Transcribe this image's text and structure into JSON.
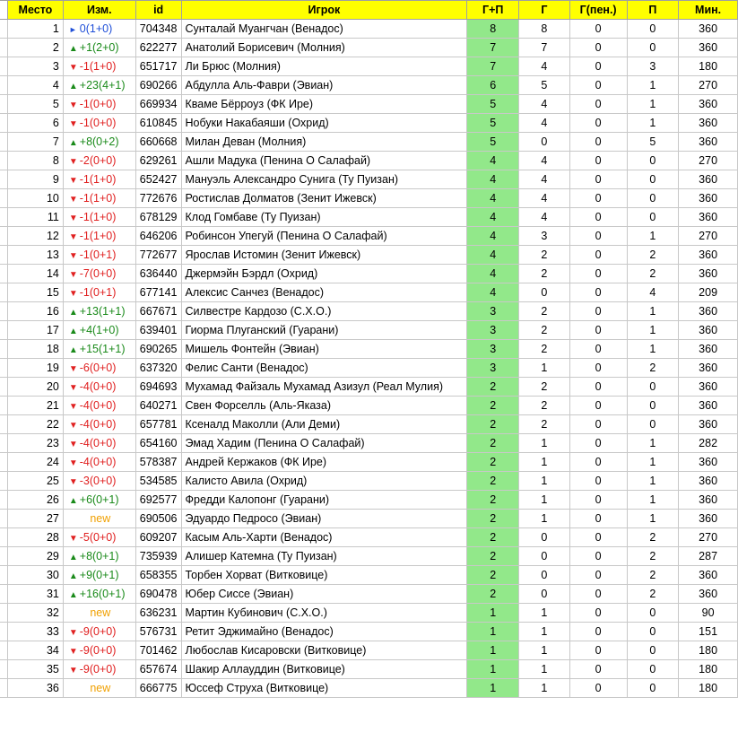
{
  "headers": {
    "place": "Место",
    "change": "Изм.",
    "id": "id",
    "player": "Игрок",
    "gp": "Г+П",
    "g": "Г",
    "gpen": "Г(пен.)",
    "p": "П",
    "min": "Мин."
  },
  "colors": {
    "header_bg": "#ffff00",
    "gp_bg": "#92e88a",
    "up": "#1a8a1a",
    "down": "#e02020",
    "same": "#1f4fd8",
    "new": "#f0a000"
  },
  "rows": [
    {
      "place": "1",
      "dir": "same",
      "change": "0(1+0)",
      "id": "704348",
      "player": "Сунталай Муангчан (Венадос)",
      "gp": "8",
      "g": "8",
      "gpen": "0",
      "p": "0",
      "min": "360"
    },
    {
      "place": "2",
      "dir": "up",
      "change": "+1(2+0)",
      "id": "622277",
      "player": "Анатолий Борисевич (Молния)",
      "gp": "7",
      "g": "7",
      "gpen": "0",
      "p": "0",
      "min": "360"
    },
    {
      "place": "3",
      "dir": "down",
      "change": "-1(1+0)",
      "id": "651717",
      "player": "Ли Брюс (Молния)",
      "gp": "7",
      "g": "4",
      "gpen": "0",
      "p": "3",
      "min": "180"
    },
    {
      "place": "4",
      "dir": "up",
      "change": "+23(4+1)",
      "id": "690266",
      "player": "Абдулла Аль-Фаври (Эвиан)",
      "gp": "6",
      "g": "5",
      "gpen": "0",
      "p": "1",
      "min": "270"
    },
    {
      "place": "5",
      "dir": "down",
      "change": "-1(0+0)",
      "id": "669934",
      "player": "Кваме Бёрроуз (ФК Ире)",
      "gp": "5",
      "g": "4",
      "gpen": "0",
      "p": "1",
      "min": "360"
    },
    {
      "place": "6",
      "dir": "down",
      "change": "-1(0+0)",
      "id": "610845",
      "player": "Нобуки Накабаяши (Охрид)",
      "gp": "5",
      "g": "4",
      "gpen": "0",
      "p": "1",
      "min": "360"
    },
    {
      "place": "7",
      "dir": "up",
      "change": "+8(0+2)",
      "id": "660668",
      "player": "Милан Деван (Молния)",
      "gp": "5",
      "g": "0",
      "gpen": "0",
      "p": "5",
      "min": "360"
    },
    {
      "place": "8",
      "dir": "down",
      "change": "-2(0+0)",
      "id": "629261",
      "player": "Ашли Мадука (Пенина О Салафай)",
      "gp": "4",
      "g": "4",
      "gpen": "0",
      "p": "0",
      "min": "270"
    },
    {
      "place": "9",
      "dir": "down",
      "change": "-1(1+0)",
      "id": "652427",
      "player": "Мануэль Александро Сунига (Ту Пуизан)",
      "gp": "4",
      "g": "4",
      "gpen": "0",
      "p": "0",
      "min": "360"
    },
    {
      "place": "10",
      "dir": "down",
      "change": "-1(1+0)",
      "id": "772676",
      "player": "Ростислав Долматов (Зенит Ижевск)",
      "gp": "4",
      "g": "4",
      "gpen": "0",
      "p": "0",
      "min": "360"
    },
    {
      "place": "11",
      "dir": "down",
      "change": "-1(1+0)",
      "id": "678129",
      "player": "Клод Гомбаве (Ту Пуизан)",
      "gp": "4",
      "g": "4",
      "gpen": "0",
      "p": "0",
      "min": "360"
    },
    {
      "place": "12",
      "dir": "down",
      "change": "-1(1+0)",
      "id": "646206",
      "player": "Робинсон Упегуй (Пенина О Салафай)",
      "gp": "4",
      "g": "3",
      "gpen": "0",
      "p": "1",
      "min": "270"
    },
    {
      "place": "13",
      "dir": "down",
      "change": "-1(0+1)",
      "id": "772677",
      "player": "Ярослав Истомин (Зенит Ижевск)",
      "gp": "4",
      "g": "2",
      "gpen": "0",
      "p": "2",
      "min": "360"
    },
    {
      "place": "14",
      "dir": "down",
      "change": "-7(0+0)",
      "id": "636440",
      "player": "Джермэйн Бэрдл (Охрид)",
      "gp": "4",
      "g": "2",
      "gpen": "0",
      "p": "2",
      "min": "360"
    },
    {
      "place": "15",
      "dir": "down",
      "change": "-1(0+1)",
      "id": "677141",
      "player": "Алексис Санчез (Венадос)",
      "gp": "4",
      "g": "0",
      "gpen": "0",
      "p": "4",
      "min": "209"
    },
    {
      "place": "16",
      "dir": "up",
      "change": "+13(1+1)",
      "id": "667671",
      "player": "Силвестре Кардозо (С.Х.О.)",
      "gp": "3",
      "g": "2",
      "gpen": "0",
      "p": "1",
      "min": "360"
    },
    {
      "place": "17",
      "dir": "up",
      "change": "+4(1+0)",
      "id": "639401",
      "player": "Гиорма Плуганский (Гуарани)",
      "gp": "3",
      "g": "2",
      "gpen": "0",
      "p": "1",
      "min": "360"
    },
    {
      "place": "18",
      "dir": "up",
      "change": "+15(1+1)",
      "id": "690265",
      "player": "Мишель Фонтейн (Эвиан)",
      "gp": "3",
      "g": "2",
      "gpen": "0",
      "p": "1",
      "min": "360"
    },
    {
      "place": "19",
      "dir": "down",
      "change": "-6(0+0)",
      "id": "637320",
      "player": "Фелис Санти (Венадос)",
      "gp": "3",
      "g": "1",
      "gpen": "0",
      "p": "2",
      "min": "360"
    },
    {
      "place": "20",
      "dir": "down",
      "change": "-4(0+0)",
      "id": "694693",
      "player": "Мухамад Файзаль Мухамад Азизул (Реал Мулия)",
      "gp": "2",
      "g": "2",
      "gpen": "0",
      "p": "0",
      "min": "360"
    },
    {
      "place": "21",
      "dir": "down",
      "change": "-4(0+0)",
      "id": "640271",
      "player": "Свен Форселль (Аль-Яказа)",
      "gp": "2",
      "g": "2",
      "gpen": "0",
      "p": "0",
      "min": "360"
    },
    {
      "place": "22",
      "dir": "down",
      "change": "-4(0+0)",
      "id": "657781",
      "player": "Ксеналд Маколли (Али Деми)",
      "gp": "2",
      "g": "2",
      "gpen": "0",
      "p": "0",
      "min": "360"
    },
    {
      "place": "23",
      "dir": "down",
      "change": "-4(0+0)",
      "id": "654160",
      "player": "Эмад Хадим (Пенина О Салафай)",
      "gp": "2",
      "g": "1",
      "gpen": "0",
      "p": "1",
      "min": "282"
    },
    {
      "place": "24",
      "dir": "down",
      "change": "-4(0+0)",
      "id": "578387",
      "player": "Андрей Кержаков (ФК Ире)",
      "gp": "2",
      "g": "1",
      "gpen": "0",
      "p": "1",
      "min": "360"
    },
    {
      "place": "25",
      "dir": "down",
      "change": "-3(0+0)",
      "id": "534585",
      "player": "Калисто Авила (Охрид)",
      "gp": "2",
      "g": "1",
      "gpen": "0",
      "p": "1",
      "min": "360"
    },
    {
      "place": "26",
      "dir": "up",
      "change": "+6(0+1)",
      "id": "692577",
      "player": "Фредди Калопонг (Гуарани)",
      "gp": "2",
      "g": "1",
      "gpen": "0",
      "p": "1",
      "min": "360"
    },
    {
      "place": "27",
      "dir": "new",
      "change": "new",
      "id": "690506",
      "player": "Эдуардо Педросо (Эвиан)",
      "gp": "2",
      "g": "1",
      "gpen": "0",
      "p": "1",
      "min": "360"
    },
    {
      "place": "28",
      "dir": "down",
      "change": "-5(0+0)",
      "id": "609207",
      "player": "Касым Аль-Харти (Венадос)",
      "gp": "2",
      "g": "0",
      "gpen": "0",
      "p": "2",
      "min": "270"
    },
    {
      "place": "29",
      "dir": "up",
      "change": "+8(0+1)",
      "id": "735939",
      "player": "Алишер Катемна (Ту Пуизан)",
      "gp": "2",
      "g": "0",
      "gpen": "0",
      "p": "2",
      "min": "287"
    },
    {
      "place": "30",
      "dir": "up",
      "change": "+9(0+1)",
      "id": "658355",
      "player": "Торбен Хорват (Витковице)",
      "gp": "2",
      "g": "0",
      "gpen": "0",
      "p": "2",
      "min": "360"
    },
    {
      "place": "31",
      "dir": "up",
      "change": "+16(0+1)",
      "id": "690478",
      "player": "Юбер Сиссе (Эвиан)",
      "gp": "2",
      "g": "0",
      "gpen": "0",
      "p": "2",
      "min": "360"
    },
    {
      "place": "32",
      "dir": "new",
      "change": "new",
      "id": "636231",
      "player": "Мартин Кубинович (С.Х.О.)",
      "gp": "1",
      "g": "1",
      "gpen": "0",
      "p": "0",
      "min": "90"
    },
    {
      "place": "33",
      "dir": "down",
      "change": "-9(0+0)",
      "id": "576731",
      "player": "Ретит Эджимайно (Венадос)",
      "gp": "1",
      "g": "1",
      "gpen": "0",
      "p": "0",
      "min": "151"
    },
    {
      "place": "34",
      "dir": "down",
      "change": "-9(0+0)",
      "id": "701462",
      "player": "Любослав Кисаровски (Витковице)",
      "gp": "1",
      "g": "1",
      "gpen": "0",
      "p": "0",
      "min": "180"
    },
    {
      "place": "35",
      "dir": "down",
      "change": "-9(0+0)",
      "id": "657674",
      "player": "Шакир Аллауддин (Витковице)",
      "gp": "1",
      "g": "1",
      "gpen": "0",
      "p": "0",
      "min": "180"
    },
    {
      "place": "36",
      "dir": "new",
      "change": "new",
      "id": "666775",
      "player": "Юссеф Струха (Витковице)",
      "gp": "1",
      "g": "1",
      "gpen": "0",
      "p": "0",
      "min": "180"
    }
  ]
}
